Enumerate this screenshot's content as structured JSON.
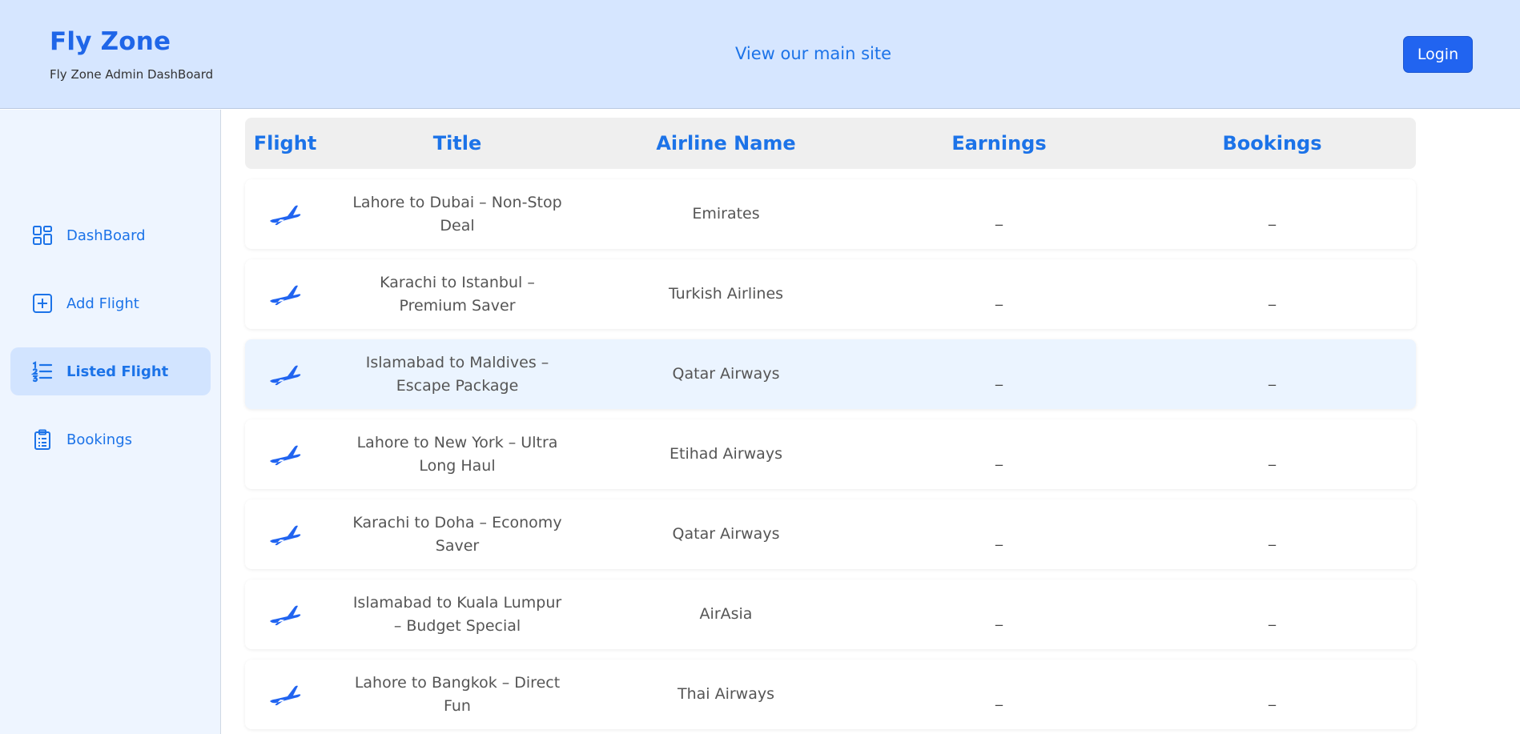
{
  "header": {
    "brand_title": "Fly Zone",
    "brand_subtitle": "Fly Zone Admin DashBoard",
    "main_site_link": "View our main site",
    "login_label": "Login"
  },
  "sidebar": {
    "items": [
      {
        "label": "DashBoard",
        "icon": "dashboard-grid-icon",
        "active": false
      },
      {
        "label": "Add Flight",
        "icon": "plus-square-icon",
        "active": false
      },
      {
        "label": "Listed Flight",
        "icon": "list-icon",
        "active": true
      },
      {
        "label": "Bookings",
        "icon": "clipboard-list-icon",
        "active": false
      }
    ]
  },
  "table": {
    "columns": [
      "Flight",
      "Title",
      "Airline Name",
      "Earnings",
      "Bookings"
    ],
    "rows": [
      {
        "title": "Lahore to Dubai – Non-Stop Deal",
        "airline": "Emirates",
        "earnings": "_",
        "bookings": "_"
      },
      {
        "title": "Karachi to Istanbul – Premium Saver",
        "airline": "Turkish Airlines",
        "earnings": "_",
        "bookings": "_"
      },
      {
        "title": "Islamabad to Maldives – Escape Package",
        "airline": "Qatar Airways",
        "earnings": "_",
        "bookings": "_"
      },
      {
        "title": "Lahore to New York – Ultra Long Haul",
        "airline": "Etihad Airways",
        "earnings": "_",
        "bookings": "_"
      },
      {
        "title": "Karachi to Doha – Economy Saver",
        "airline": "Qatar Airways",
        "earnings": "_",
        "bookings": "_"
      },
      {
        "title": "Islamabad to Kuala Lumpur – Budget Special",
        "airline": "AirAsia",
        "earnings": "_",
        "bookings": "_"
      },
      {
        "title": "Lahore to Bangkok – Direct Fun",
        "airline": "Thai Airways",
        "earnings": "_",
        "bookings": "_"
      }
    ],
    "flight_icon": "airplane-icon"
  },
  "colors": {
    "header_bg": "#d6e6ff",
    "sidebar_bg": "#eef5ff",
    "accent": "#1c73e8",
    "login_bg": "#2164f0",
    "active_nav_bg": "#d2e4ff",
    "highlight_row_bg": "#ebf4ff"
  }
}
